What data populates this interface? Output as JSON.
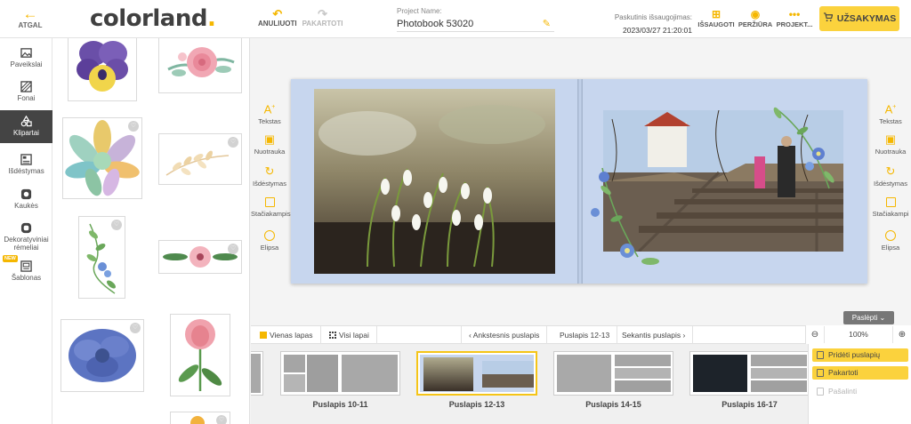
{
  "header": {
    "back_label": "ATGAL",
    "logo_main": "colorland",
    "logo_dot": ".",
    "undo_label": "ANULIUOTI",
    "redo_label": "PAKARTOTI",
    "project_label": "Project Name:",
    "project_name": "Photobook 53020",
    "last_saved_label": "Paskutinis išsaugojimas:",
    "last_saved_time": "2023/03/27 21:20:01",
    "save_label": "IŠSAUGOTI",
    "preview_label": "PERŽIŪRA",
    "project_label_btn": "PROJEKT...",
    "order_label": "UŽSAKYMAS"
  },
  "tools": [
    {
      "label": "Paveikslai",
      "icon": "image-icon"
    },
    {
      "label": "Fonai",
      "icon": "background-icon"
    },
    {
      "label": "Klipartai",
      "icon": "clipart-icon",
      "active": true
    },
    {
      "label": "Išdėstymas",
      "icon": "layout-icon"
    },
    {
      "label": "Kaukės",
      "icon": "mask-icon"
    },
    {
      "label": "Dekoratyviniai rėmeliai",
      "icon": "frame-icon"
    },
    {
      "label": "Šablonas",
      "icon": "template-icon"
    }
  ],
  "new_badge": "NEW",
  "left_side_tools": [
    "Tekstas",
    "Nuotrauka",
    "Išdėstymas",
    "Stačiakampis",
    "Elipsa"
  ],
  "right_side_tools": [
    "Tekstas",
    "Nuotrauka",
    "Išdėstymas",
    "Stačiakampi",
    "Elipsa"
  ],
  "bottom": {
    "hide_label": "Paslėpti",
    "single_page": "Vienas lapas",
    "all_pages": "Visi lapai",
    "prev_page": "Ankstesnis puslapis",
    "current_page": "Puslapis 12-13",
    "next_page": "Sekantis puslapis",
    "zoom": "100%"
  },
  "thumbnails": [
    {
      "label": "Puslapis 10-11"
    },
    {
      "label": "Puslapis 12-13",
      "selected": true
    },
    {
      "label": "Puslapis 14-15"
    },
    {
      "label": "Puslapis 16-17"
    }
  ],
  "page_menu": {
    "add": "Pridėti puslapių",
    "repeat": "Pakartoti",
    "delete": "Pašalinti"
  },
  "colors": {
    "accent": "#f5b700",
    "order_button": "#fbd23d",
    "spread_background": "#c7d6ee"
  }
}
